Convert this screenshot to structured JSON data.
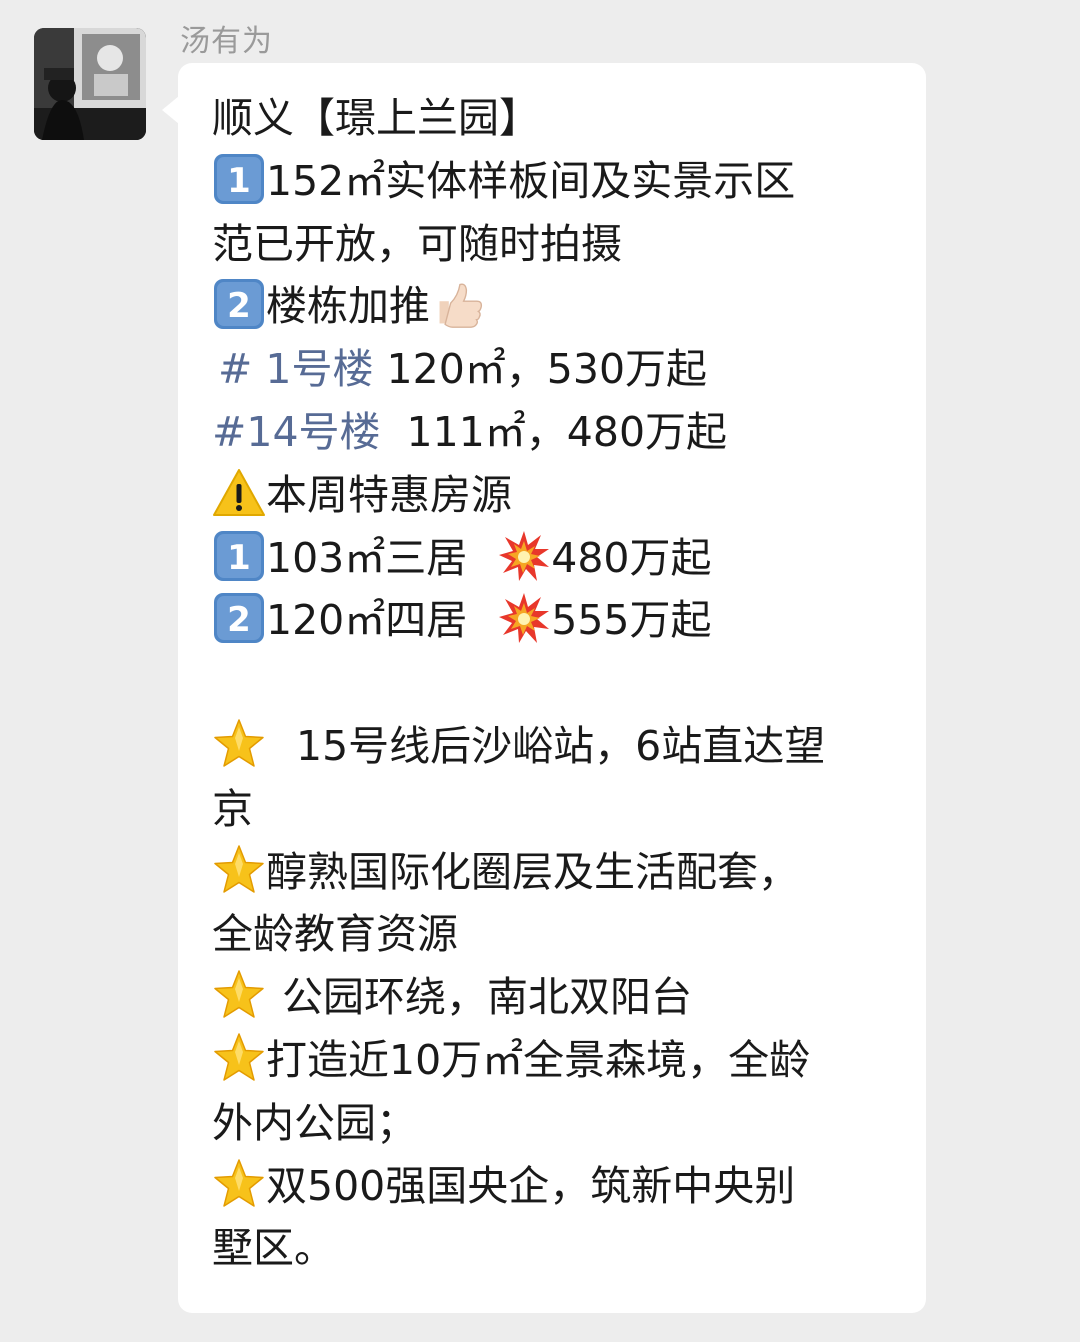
{
  "sender": {
    "name": "汤有为"
  },
  "message": {
    "lines": [
      "顺义【璟上兰园】",
      "152㎡实体样板间及实景示区",
      "范已开放，可随时拍摄",
      "楼栋加推",
      "# 1号楼",
      "120㎡，530万起",
      "#14号楼",
      "111㎡，480万起",
      "本周特惠房源",
      "103㎡三居",
      "480万起",
      "120㎡四居",
      "555万起",
      "15号线后沙峪站，6站直达望",
      "京",
      "醇熟国际化圈层及生活配套，",
      "全龄教育资源",
      "公园环绕，南北双阳台",
      "打造近10万㎡全景森境，全龄",
      "外内公园；",
      "双500强国央企，筑新中央别",
      "墅区。"
    ],
    "keycap_1": "1",
    "keycap_2": "2",
    "icons": {
      "keycap_one": "keycap-one-icon",
      "keycap_two": "keycap-two-icon",
      "thumbs_up": "thumbs-up-icon",
      "warning": "warning-icon",
      "collision": "collision-icon",
      "star": "star-icon"
    }
  },
  "colors": {
    "background": "#ededed",
    "bubble": "#ffffff",
    "text": "#1a1a1a",
    "hashtag": "#576b95",
    "sender_name": "#9a9a9a",
    "keycap": "#4f86c6",
    "star": "#f7c21a",
    "warning": "#f7c21a"
  }
}
